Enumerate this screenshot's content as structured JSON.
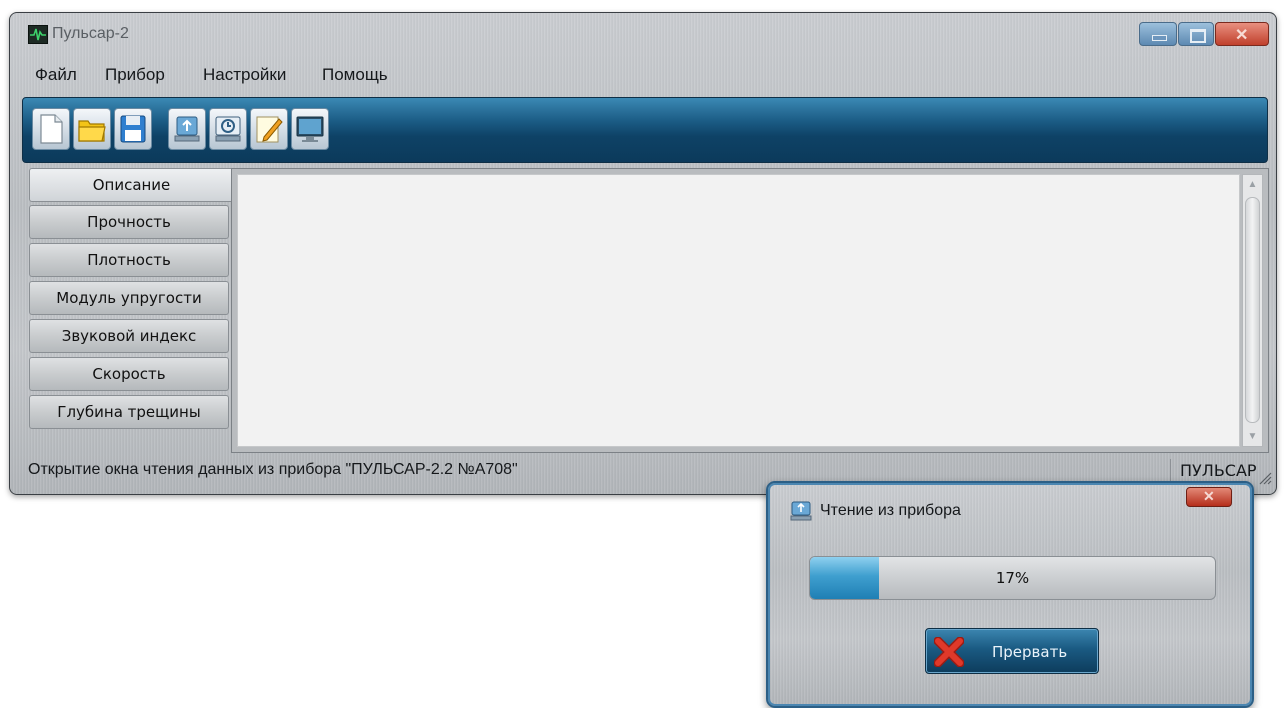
{
  "window": {
    "title": "Пульсар-2",
    "menu": [
      "Файл",
      "Прибор",
      "Настройки",
      "Помощь"
    ],
    "toolbar": [
      "new-file-icon",
      "open-folder-icon",
      "save-icon",
      "device-usb-icon",
      "history-icon",
      "edit-note-icon",
      "monitor-icon"
    ],
    "sidebar": [
      "Описание",
      "Прочность",
      "Плотность",
      "Модуль упругости",
      "Звуковой индекс",
      "Скорость",
      "Глубина трещины"
    ],
    "active_tab": "Описание",
    "status": {
      "text": "Открытие окна чтения данных из прибора \"ПУЛЬСАР-2.2 №А708\"",
      "right": "ПУЛЬСАР"
    }
  },
  "dialog": {
    "title": "Чтение из прибора",
    "progress_value": 0.17,
    "progress_label": "17%",
    "abort_label": "Прервать"
  },
  "colors": {
    "toolbar_blue": "#1c5d86",
    "progress_fill": "#3f9fcf",
    "close_red": "#c0402c"
  }
}
